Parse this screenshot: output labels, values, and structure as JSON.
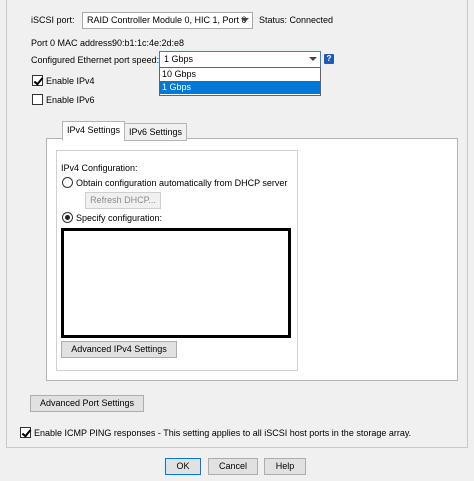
{
  "top": {
    "iscsi_port_label": "iSCSI port:",
    "iscsi_port_value": "RAID Controller Module 0, HIC 1, Port 0",
    "status_text": "Status: Connected",
    "mac_label": "Port 0 MAC address:",
    "mac_value": "90:b1:1c:4e:2d:e8",
    "speed_label": "Configured Ethernet port speed:",
    "speed_value": "1 Gbps",
    "speed_options": [
      "10 Gbps",
      "1 Gbps"
    ],
    "help_icon": "?"
  },
  "checks": {
    "enable_ipv4": "Enable IPv4",
    "enable_ipv6": "Enable IPv6"
  },
  "tabs": {
    "ipv4": "IPv4 Settings",
    "ipv6": "IPv6 Settings"
  },
  "ipv4": {
    "heading": "IPv4 Configuration:",
    "dhcp_label": "Obtain configuration automatically from DHCP server",
    "refresh_button": "Refresh DHCP...",
    "specify_label": "Specify configuration:",
    "advanced_button": "Advanced IPv4 Settings"
  },
  "advanced_port_button": "Advanced Port Settings",
  "icmp_label": "Enable ICMP PING responses - This setting applies to all iSCSI host ports in the storage array.",
  "footer": {
    "ok": "OK",
    "cancel": "Cancel",
    "help": "Help"
  },
  "colors": {
    "selection": "#0078d7",
    "help_icon": "#1e5bbf"
  }
}
